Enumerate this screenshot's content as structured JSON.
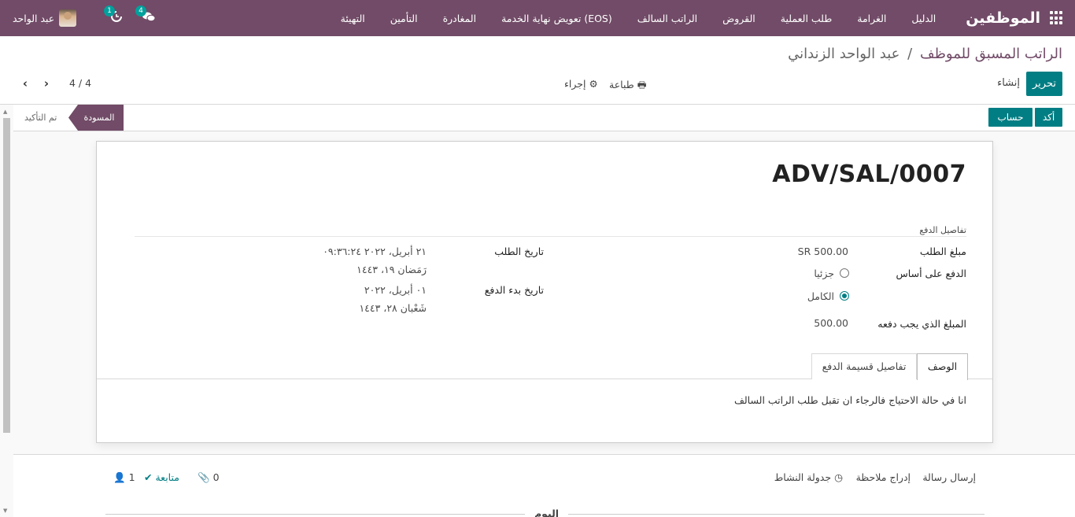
{
  "navbar": {
    "brand": "الموظفين",
    "menu": [
      "الدليل",
      "الغرامة",
      "طلب العملية",
      "القروض",
      "الراتب السالف",
      "تعويض نهاية الخدمة (EOS)",
      "المغادرة",
      "التأمين",
      "التهيئة"
    ],
    "user_name": "عبد الواحد",
    "messages_count": "4",
    "activities_count": "1",
    "bg_color": "#714b67"
  },
  "control_panel": {
    "breadcrumb_parent": "الراتب المسبق للموظف",
    "breadcrumb_sep": "/",
    "breadcrumb_current": "عبد الواحد الزنداني",
    "edit_label": "تحرير",
    "create_label": "إنشاء",
    "print_label": "طباعة",
    "action_label": "إجراء",
    "pager": "4 / 4"
  },
  "statusbar": {
    "confirm_label": "أكد",
    "compute_label": "حساب",
    "stage_active": "المسودة",
    "stage_other": "تم التأكيد"
  },
  "record": {
    "name": "ADV/SAL/0007",
    "group_title": "تفاصيل الدفع",
    "amount_label": "مبلغ الطلب",
    "amount_value": "SR 500.00",
    "payment_basis_label": "الدفع على أساس",
    "option_partial": "جزئيا",
    "option_full": "الكامل",
    "payable_label": "المبلغ الذي يجب دفعه",
    "payable_value": "500.00",
    "request_date_label": "تاريخ الطلب",
    "request_date_value": "٢١ أبريل، ٢٠٢٢ ٠٩:٣٦:٢٤",
    "request_date_hijri": "رَمَضان ١٩، ١٤٤٣",
    "start_date_label": "تاريخ بدء الدفع",
    "start_date_value": "٠١ أبريل، ٢٠٢٢",
    "start_date_hijri": "شَعْبان ٢٨، ١٤٤٣"
  },
  "tabs": {
    "description": "الوصف",
    "installments": "تفاصيل قسيمة الدفع",
    "description_text": "انا في حالة الاحتياج فالرجاء ان تقبل طلب الراتب السالف"
  },
  "chatter": {
    "send_message": "إرسال رسالة",
    "log_note": "إدراج ملاحظة",
    "schedule_activity": "جدولة النشاط",
    "attachments_count": "0",
    "follow_label": "متابعة",
    "followers_count": "1",
    "today": "اليوم"
  }
}
